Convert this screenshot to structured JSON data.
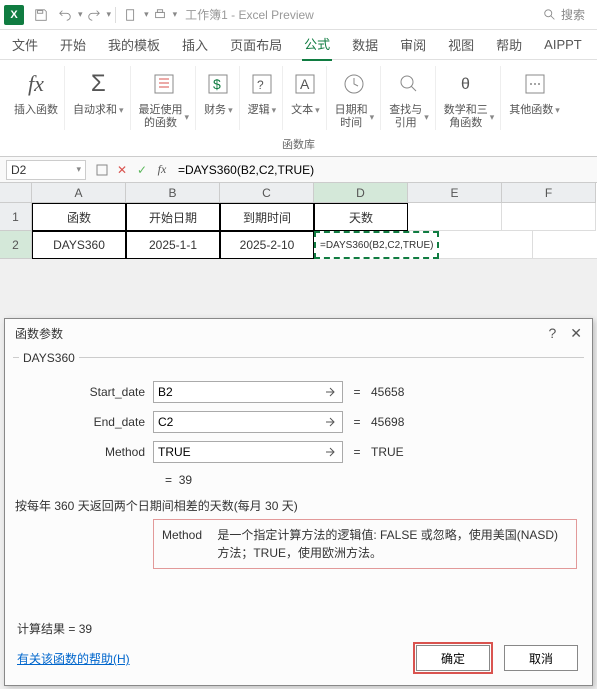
{
  "titlebar": {
    "doc_name": "工作簿1",
    "app_suffix": "Excel Preview",
    "search_placeholder": "搜索"
  },
  "tabs": {
    "items": [
      "文件",
      "开始",
      "我的模板",
      "插入",
      "页面布局",
      "公式",
      "数据",
      "审阅",
      "视图",
      "帮助",
      "AIPPT"
    ],
    "active_index": 5
  },
  "ribbon": {
    "groups": [
      {
        "label": "插入函数",
        "icon": "fx"
      },
      {
        "label": "自动求和",
        "icon": "sum",
        "dd": true
      },
      {
        "label": "最近使用的函数",
        "icon": "recent",
        "dd": true
      },
      {
        "label": "财务",
        "icon": "finance",
        "dd": true
      },
      {
        "label": "逻辑",
        "icon": "logic",
        "dd": true
      },
      {
        "label": "文本",
        "icon": "text",
        "dd": true
      },
      {
        "label": "日期和时间",
        "icon": "date",
        "dd": true
      },
      {
        "label": "查找与引用",
        "icon": "lookup",
        "dd": true
      },
      {
        "label": "数学和三角函数",
        "icon": "math",
        "dd": true
      },
      {
        "label": "其他函数",
        "icon": "more",
        "dd": true
      }
    ],
    "caption": "函数库"
  },
  "formula_bar": {
    "name_box": "D2",
    "formula": "=DAYS360(B2,C2,TRUE)"
  },
  "grid": {
    "cols": [
      "A",
      "B",
      "C",
      "D",
      "E",
      "F"
    ],
    "selected_col_index": 3,
    "rows": [
      {
        "num": "1",
        "cells": [
          {
            "v": "函数",
            "b": true
          },
          {
            "v": "开始日期",
            "b": true
          },
          {
            "v": "到期时间",
            "b": true
          },
          {
            "v": "天数",
            "b": true
          },
          {
            "v": ""
          },
          {
            "v": ""
          }
        ]
      },
      {
        "num": "2",
        "selected": true,
        "cells": [
          {
            "v": "DAYS360",
            "b": true
          },
          {
            "v": "2025-1-1",
            "b": true
          },
          {
            "v": "2025-2-10",
            "b": true
          },
          {
            "v": "=DAYS360(B2,C2,TRUE)",
            "b": true,
            "active": true
          },
          {
            "v": ""
          },
          {
            "v": ""
          }
        ]
      }
    ]
  },
  "dialog": {
    "title": "函数参数",
    "func_name": "DAYS360",
    "params": [
      {
        "label": "Start_date",
        "value": "B2",
        "result": "45658"
      },
      {
        "label": "End_date",
        "value": "C2",
        "result": "45698"
      },
      {
        "label": "Method",
        "value": "TRUE",
        "result": "TRUE"
      }
    ],
    "formula_result": "39",
    "description": "按每年 360 天返回两个日期间相差的天数(每月 30 天)",
    "info_label": "Method",
    "info_text": "是一个指定计算方法的逻辑值: FALSE 或忽略，使用美国(NASD)方法；TRUE，使用欧洲方法。",
    "calc_result_label": "计算结果 = ",
    "calc_result_value": "39",
    "help_link": "有关该函数的帮助(H)",
    "ok": "确定",
    "cancel": "取消"
  }
}
